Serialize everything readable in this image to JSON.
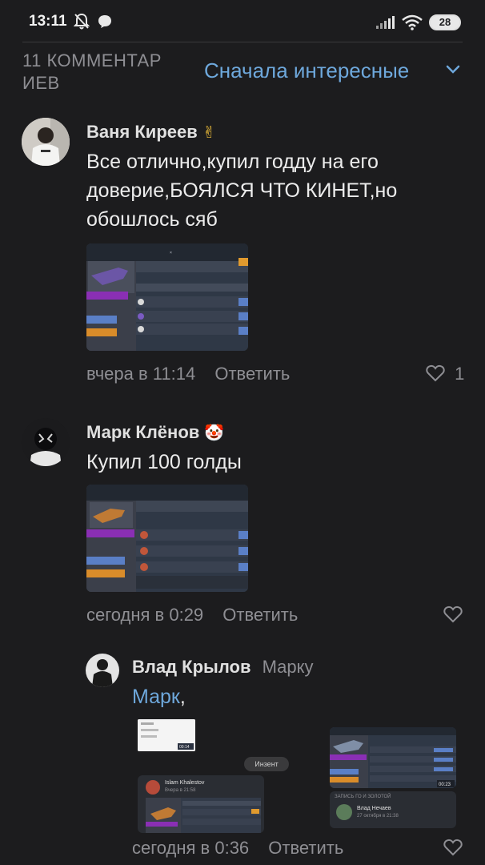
{
  "status_bar": {
    "time": "13:11",
    "battery": "28"
  },
  "header": {
    "comments_count": "11 КОММЕНТАР ИЕВ",
    "sort_label": "Сначала интересные"
  },
  "comments": [
    {
      "author": "Ваня Киреев",
      "author_emoji": "✌",
      "text": "Все отлично,купил годду на его доверие,БОЯЛСЯ ЧТО КИНЕТ,но обошлось сяб",
      "date": "вчера в 11:14",
      "reply_label": "Ответить",
      "likes": "1"
    },
    {
      "author": "Марк Клёнов",
      "author_emoji": "🤡",
      "text": "Купил 100 голды",
      "date": "сегодня в 0:29",
      "reply_label": "Ответить",
      "likes": ""
    },
    {
      "author": "Влад Крылов",
      "reply_to": "Марку",
      "mention": "Марк",
      "text_suffix": ",",
      "date": "сегодня в 0:36",
      "reply_label": "Ответить",
      "likes": ""
    }
  ],
  "attachment_3_texts": {
    "chip": "Инзент",
    "user1": "Islam Khalestov",
    "user1_sub": "Вчера в 21:58",
    "user2": "Влад Нечаев",
    "user2_sub": "27 октября в 21:38",
    "section": "ЗАПИСЬ ГО И ЗОЛОТОЙ",
    "time_a": "00:14",
    "time_b": "00:23"
  },
  "colors": {
    "background": "#1c1c1e",
    "accent": "#6ea8dc",
    "muted": "#8e8e93",
    "text": "#ececec"
  }
}
